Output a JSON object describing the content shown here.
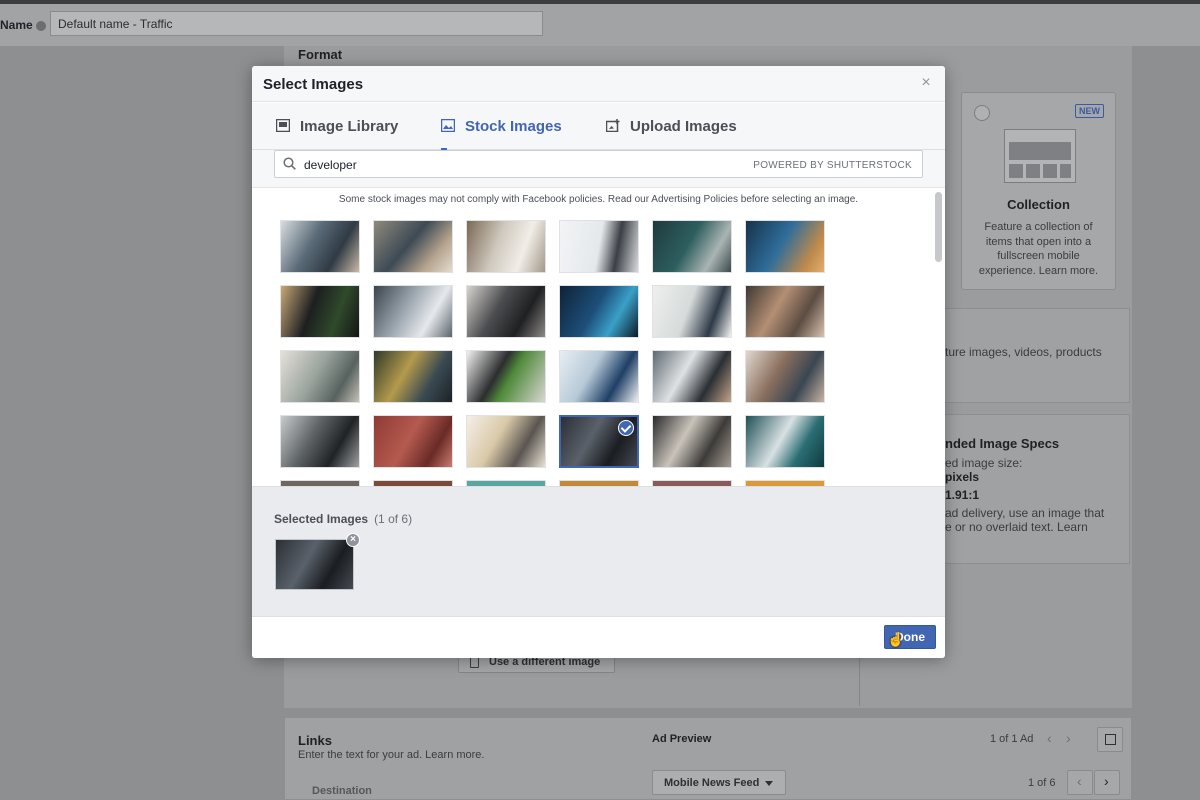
{
  "page": {
    "name_label": "Name",
    "name_value": "Default name - Traffic",
    "format_heading": "Format",
    "collection": {
      "badge": "NEW",
      "title": "Collection",
      "description": "Feature a collection of items that open into a fullscreen mobile experience. Learn more."
    },
    "side_text_1": "ture images, videos, products",
    "specs": {
      "heading": "nded Image Specs",
      "line1": "ed image size:",
      "line2": "pixels",
      "line3": "1.91:1",
      "line4": "ad delivery, use an image that",
      "line5": "e or no overlaid text. Learn"
    },
    "use_different_image": "Use a different image",
    "links": {
      "heading": "Links",
      "subtext": "Enter the text for your ad. Learn more.",
      "destination": "Destination"
    },
    "ad_preview": {
      "heading": "Ad Preview",
      "count": "1 of 1 Ad",
      "placement": "Mobile News Feed",
      "page_count": "1 of 6"
    }
  },
  "modal": {
    "title": "Select Images",
    "tabs": [
      {
        "label": "Image Library",
        "icon": "image-library-icon",
        "active": false
      },
      {
        "label": "Stock Images",
        "icon": "stock-images-icon",
        "active": true
      },
      {
        "label": "Upload Images",
        "icon": "upload-images-icon",
        "active": false
      }
    ],
    "search": {
      "value": "developer",
      "powered_by": "POWERED BY SHUTTERSTOCK"
    },
    "notice": "Some stock images may not comply with Facebook policies. Read our Advertising Policies before selecting an image.",
    "selected_label": "Selected Images",
    "selected_count": "(1 of 6)",
    "done_label": "Done"
  },
  "colors": {
    "accent": "#4267b2"
  }
}
